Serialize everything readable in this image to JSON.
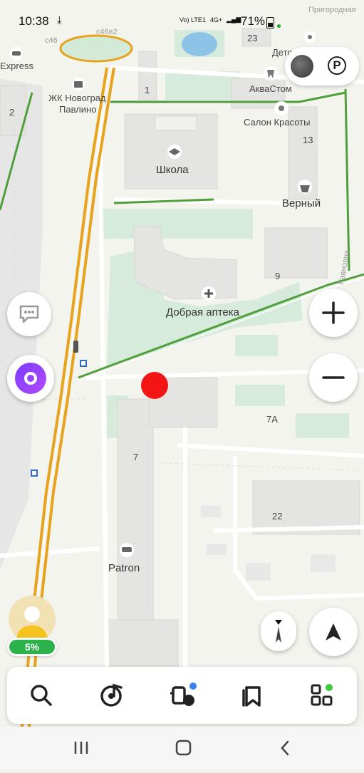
{
  "status_bar": {
    "time": "10:38",
    "battery_percent": "71%",
    "network_1": "Vo) LTE1",
    "network_2": "4G+"
  },
  "map": {
    "labels": {
      "pharmacy": "Добрая аптека",
      "school": "Школа",
      "store": "Верный",
      "salon": "Салон Красоты",
      "dental": "АкваСтом",
      "kindergarten": "Детский сад",
      "complex_line1": "ЖК Новоград",
      "complex_line2": "Павлино",
      "express": "Express",
      "patron": "Patron",
      "road_top": "Пригородная",
      "road_right": "Равновна",
      "road_c46": "с46",
      "road_c46b2": "с46в2"
    },
    "house_numbers": {
      "h1": "1",
      "h2": "2",
      "h23": "23",
      "h13": "13",
      "h9": "9",
      "h7": "7",
      "h7a": "7А",
      "h22": "22"
    }
  },
  "controls": {
    "zoom_in_icon": "plus-icon",
    "zoom_out_icon": "minus-icon",
    "parking_label": "P",
    "compass_icon": "compass-icon",
    "navigate_icon": "arrow-navigation-icon"
  },
  "user": {
    "level_badge": "5%"
  },
  "bottom_bar": {
    "items": [
      "search-icon",
      "music-icon",
      "transport-icon",
      "bookmarks-icon",
      "services-icon"
    ]
  },
  "colors": {
    "route": "#e8a31c",
    "greenery": "#d4ead9",
    "alice": "#8a3cff",
    "badge": "#2cb24a",
    "marker": "#f31414"
  }
}
